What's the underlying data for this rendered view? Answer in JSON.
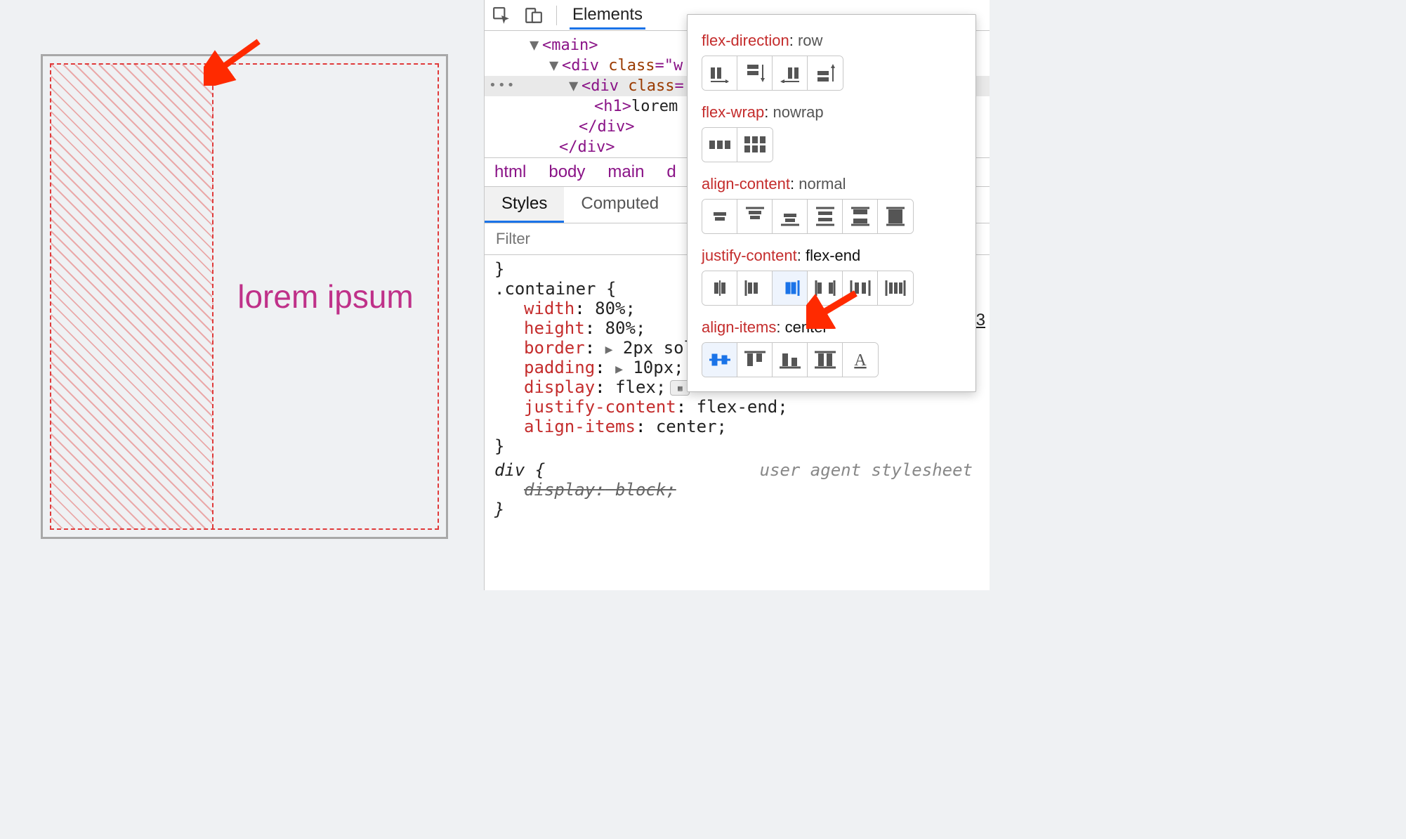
{
  "left": {
    "heading": "lorem ipsum"
  },
  "devtools": {
    "tab_elements": "Elements",
    "dom": {
      "l1": "<main>",
      "l2a": "<div ",
      "l2b": "class",
      "l2c": "=\"w",
      "l3a": "<div ",
      "l3b": "class",
      "l3c": "=",
      "l4a": "<h1>",
      "l4b": "lorem",
      "l5": "</div>",
      "l6": "</div>"
    },
    "breadcrumbs": {
      "a": "html",
      "b": "body",
      "c": "main",
      "d": "d"
    },
    "styles_tabs": {
      "a": "Styles",
      "b": "Computed"
    },
    "filter_placeholder": "Filter",
    "css": {
      "close_brace1": "}",
      "sel1": ".container {",
      "p1": "width",
      "v1": "80%;",
      "p2": "height",
      "v2": "80%;",
      "p3": "border",
      "v3": "2px sol",
      "p4": "padding",
      "v4": "10px;",
      "p5": "display",
      "v5": "flex;",
      "p6": "justify-content",
      "v6": "flex-end;",
      "p7": "align-items",
      "v7": "center;",
      "close_brace2": "}",
      "sel2": "div {",
      "uas": "user agent stylesheet",
      "pd": "display:",
      "vd": "block;",
      "close_brace3": "}"
    },
    "line_ref": "13"
  },
  "popover": {
    "flex_direction": {
      "name": "flex-direction",
      "value": "row"
    },
    "flex_wrap": {
      "name": "flex-wrap",
      "value": "nowrap"
    },
    "align_content": {
      "name": "align-content",
      "value": "normal"
    },
    "justify_content": {
      "name": "justify-content",
      "value": "flex-end"
    },
    "align_items": {
      "name": "align-items",
      "value": "center"
    }
  }
}
